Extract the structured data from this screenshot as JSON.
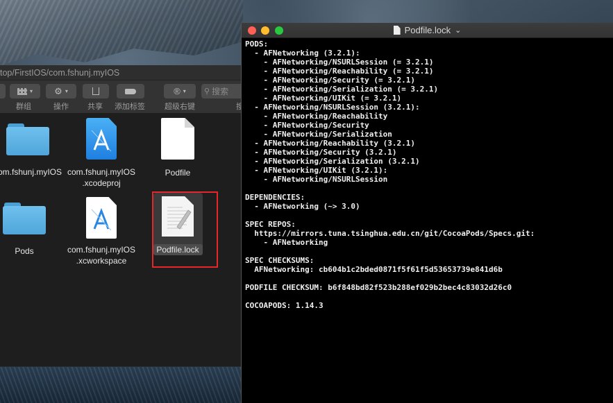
{
  "finder": {
    "path": "top/FirstIOS/com.fshunj.myIOS",
    "toolbar": {
      "group_label": "群组",
      "action_label": "操作",
      "share_label": "共享",
      "tag_label": "添加标签",
      "right_click_label": "超级右键",
      "search_placeholder": "搜索",
      "cut_label": "搜"
    },
    "files": [
      {
        "name_line1": "com.fshunj.myIOS",
        "name_line2": "",
        "icon": "folder-icon"
      },
      {
        "name_line1": "com.fshunj.myIOS",
        "name_line2": ".xcodeproj",
        "icon": "xcodeproj-icon"
      },
      {
        "name_line1": "Podfile",
        "name_line2": "",
        "icon": "document-icon"
      },
      {
        "name_line1": "Pods",
        "name_line2": "",
        "icon": "folder-icon"
      },
      {
        "name_line1": "com.fshunj.myIOS",
        "name_line2": ".xcworkspace",
        "icon": "xcworkspace-icon"
      },
      {
        "name_line1": "Podfile.lock",
        "name_line2": "",
        "icon": "text-document-icon"
      }
    ]
  },
  "terminal": {
    "title": "Podfile.lock",
    "title_chevron": "⌄",
    "traffic_colors": {
      "close": "#fe5f57",
      "minimize": "#febc2e",
      "zoom": "#28c840"
    },
    "lines": [
      "PODS:",
      "  - AFNetworking (3.2.1):",
      "    - AFNetworking/NSURLSession (= 3.2.1)",
      "    - AFNetworking/Reachability (= 3.2.1)",
      "    - AFNetworking/Security (= 3.2.1)",
      "    - AFNetworking/Serialization (= 3.2.1)",
      "    - AFNetworking/UIKit (= 3.2.1)",
      "  - AFNetworking/NSURLSession (3.2.1):",
      "    - AFNetworking/Reachability",
      "    - AFNetworking/Security",
      "    - AFNetworking/Serialization",
      "  - AFNetworking/Reachability (3.2.1)",
      "  - AFNetworking/Security (3.2.1)",
      "  - AFNetworking/Serialization (3.2.1)",
      "  - AFNetworking/UIKit (3.2.1):",
      "    - AFNetworking/NSURLSession",
      "",
      "DEPENDENCIES:",
      "  - AFNetworking (~> 3.0)",
      "",
      "SPEC REPOS:",
      "  https://mirrors.tuna.tsinghua.edu.cn/git/CocoaPods/Specs.git:",
      "    - AFNetworking",
      "",
      "SPEC CHECKSUMS:",
      "  AFNetworking: cb604b1c2bded0871f5f61f5d53653739e841d6b",
      "",
      "PODFILE CHECKSUM: b6f848bd82f523b288ef029b2bec4c83032d26c0",
      "",
      "COCOAPODS: 1.14.3"
    ]
  }
}
